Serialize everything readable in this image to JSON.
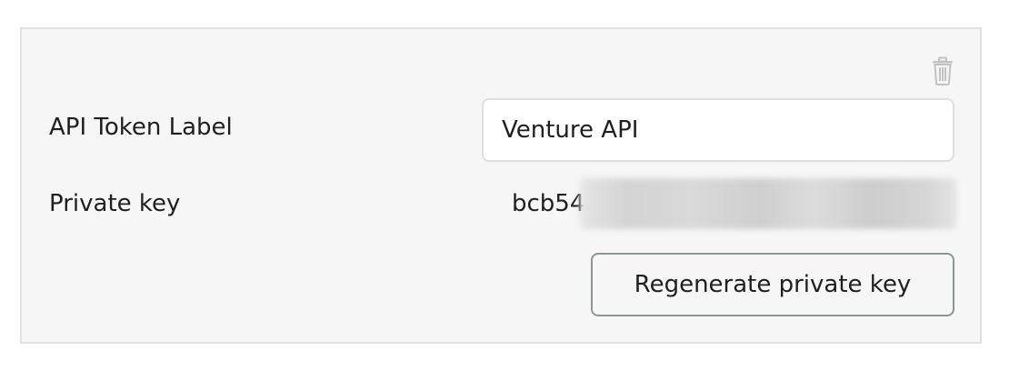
{
  "token": {
    "label": "API Token Label",
    "value": "Venture API"
  },
  "private_key": {
    "label": "Private key",
    "visible_prefix": "bcb54"
  },
  "actions": {
    "regenerate_label": "Regenerate private key",
    "delete_icon": "trash-icon"
  }
}
